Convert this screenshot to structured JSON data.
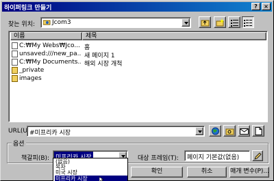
{
  "window": {
    "title": "하이퍼링크 만들기",
    "help_label": "?",
    "close_label": "×"
  },
  "lookin": {
    "label": "찾는 위치:",
    "value": "Jcom3"
  },
  "file_list": {
    "columns": [
      "이름",
      "제목"
    ],
    "rows": [
      {
        "type": "page",
        "name": "C:₩My Webs₩Jco...",
        "title": "홈"
      },
      {
        "type": "page",
        "name": "unsaved:///new_pa...",
        "title": "새 페이지 1"
      },
      {
        "type": "page",
        "name": "C:₩My Documents...",
        "title": "해외 시장 개척"
      },
      {
        "type": "folder",
        "name": "_private",
        "title": ""
      },
      {
        "type": "folder",
        "name": "images",
        "title": ""
      }
    ]
  },
  "url": {
    "label": "URL(U):",
    "value": "#미프리카 시장"
  },
  "options": {
    "legend": "옵션",
    "bookmark_label": "책갈피(B):",
    "bookmark_value": "미프리카 시장",
    "target_frame_label": "대상 프레임(T):",
    "target_frame_value": "페이지 기본값(없음)"
  },
  "bookmark_dropdown": {
    "options": [
      "(없음)",
      "목차",
      "미국 시장",
      "미프리카 시장"
    ],
    "selected_index": 3
  },
  "buttons": {
    "ok": "확인",
    "cancel": "취소",
    "params": "매개 변수(P)..."
  },
  "colors": {
    "titlebar": "#000080",
    "face": "#c0c0c0",
    "highlight": "#000080"
  }
}
